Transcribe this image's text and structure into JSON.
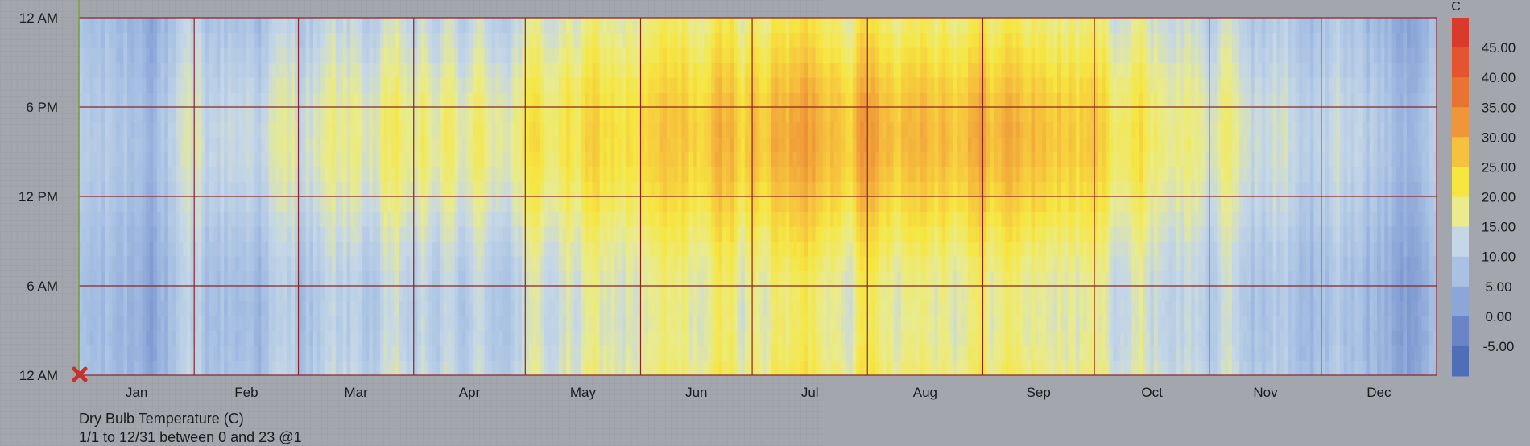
{
  "chart_data": {
    "type": "heatmap",
    "unit": "C",
    "title": "Dry Bulb Temperature (C)",
    "subtitle": "1/1 to 12/31 between 0 and 23 @1",
    "x_tick_labels": [
      "Jan",
      "Feb",
      "Mar",
      "Apr",
      "May",
      "Jun",
      "Jul",
      "Aug",
      "Sep",
      "Oct",
      "Nov",
      "Dec"
    ],
    "y_tick_labels": [
      "12 AM",
      "6 AM",
      "12 PM",
      "6 PM",
      "12 AM"
    ],
    "y_range": [
      0,
      24
    ],
    "legend_title": "C",
    "legend_labels": [
      "45.00",
      "40.00",
      "35.00",
      "30.00",
      "25.00",
      "20.00",
      "15.00",
      "10.00",
      "5.00",
      "0.00",
      "-5.00"
    ],
    "legend_colors": [
      "#d93a2c",
      "#e4542f",
      "#e87432",
      "#ee9638",
      "#f6c13d",
      "#f6e640",
      "#e9eb8d",
      "#c5d7e6",
      "#a9c2e4",
      "#8da6d8",
      "#6a85c5",
      "#4e6fb7"
    ],
    "legend_range": [
      -5,
      50
    ],
    "months": [
      {
        "name": "Jan",
        "avg_night": 8,
        "avg_afternoon": 11
      },
      {
        "name": "Feb",
        "avg_night": 10,
        "avg_afternoon": 16
      },
      {
        "name": "Mar",
        "avg_night": 12,
        "avg_afternoon": 19
      },
      {
        "name": "Apr",
        "avg_night": 12,
        "avg_afternoon": 20
      },
      {
        "name": "May",
        "avg_night": 17,
        "avg_afternoon": 25
      },
      {
        "name": "Jun",
        "avg_night": 19,
        "avg_afternoon": 28
      },
      {
        "name": "Jul",
        "avg_night": 22,
        "avg_afternoon": 33
      },
      {
        "name": "Aug",
        "avg_night": 22,
        "avg_afternoon": 33
      },
      {
        "name": "Sep",
        "avg_night": 20,
        "avg_afternoon": 31
      },
      {
        "name": "Oct",
        "avg_night": 16,
        "avg_afternoon": 23
      },
      {
        "name": "Nov",
        "avg_night": 11,
        "avg_afternoon": 16
      },
      {
        "name": "Dec",
        "avg_night": 8,
        "avg_afternoon": 12
      }
    ],
    "grid": true,
    "legend_position": "right"
  }
}
